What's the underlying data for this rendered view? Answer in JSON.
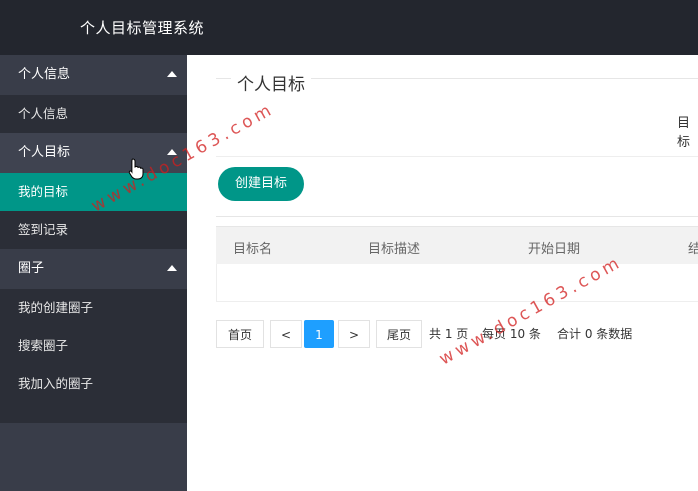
{
  "app": {
    "title": "个人目标管理系统"
  },
  "sidebar": {
    "groups": [
      {
        "label": "个人信息",
        "items": [
          "个人信息"
        ]
      },
      {
        "label": "个人目标",
        "items": [
          "我的目标",
          "签到记录"
        ]
      },
      {
        "label": "圈子",
        "items": [
          "我的创建圈子",
          "搜索圈子",
          "我加入的圈子"
        ]
      }
    ],
    "active_item": "我的目标"
  },
  "main": {
    "title": "个人目标",
    "tab_label": "目标",
    "create_button": "创建目标",
    "table": {
      "headers": [
        "目标名",
        "目标描述",
        "开始日期",
        "结"
      ]
    },
    "pagination": {
      "first": "首页",
      "prev": "<",
      "current": "1",
      "next": ">",
      "last": "尾页",
      "total_pages": "共 1 页",
      "per_page": "每页 10 条",
      "total": "合计 0 条数据"
    }
  },
  "watermark": "www.doc163.com",
  "colors": {
    "topbar": "#23262e",
    "sidebar": "#393d49",
    "accent": "#009688",
    "pager_active": "#1e9fff"
  }
}
